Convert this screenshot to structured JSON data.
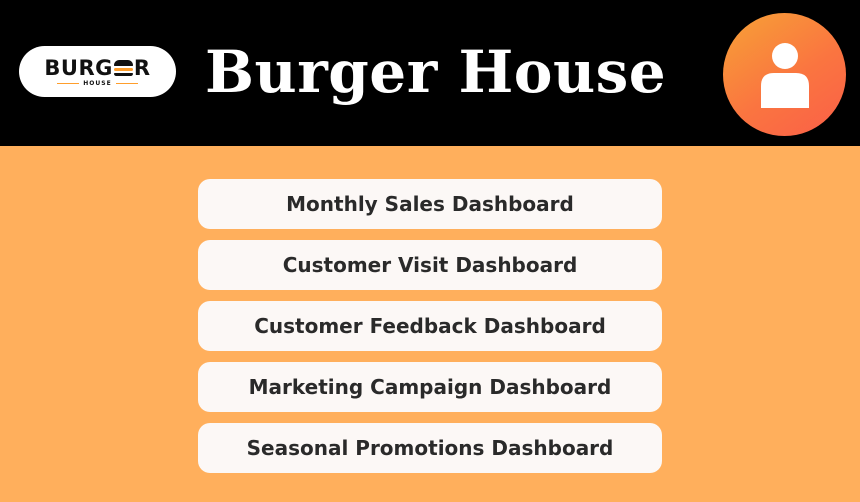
{
  "header": {
    "logo": {
      "word_left": "BURG",
      "word_right": "R",
      "subtitle": "HOUSE"
    },
    "title": "Burger House",
    "avatar_icon": "user-icon"
  },
  "menu": {
    "items": [
      {
        "label": "Monthly Sales Dashboard"
      },
      {
        "label": "Customer Visit Dashboard"
      },
      {
        "label": "Customer Feedback Dashboard"
      },
      {
        "label": "Marketing Campaign Dashboard"
      },
      {
        "label": "Seasonal Promotions Dashboard"
      }
    ]
  },
  "colors": {
    "background": "#FFAF5C",
    "header": "#000000",
    "item_background": "#FCF8F6",
    "accent_start": "#F7A236",
    "accent_end": "#FB5F48"
  }
}
